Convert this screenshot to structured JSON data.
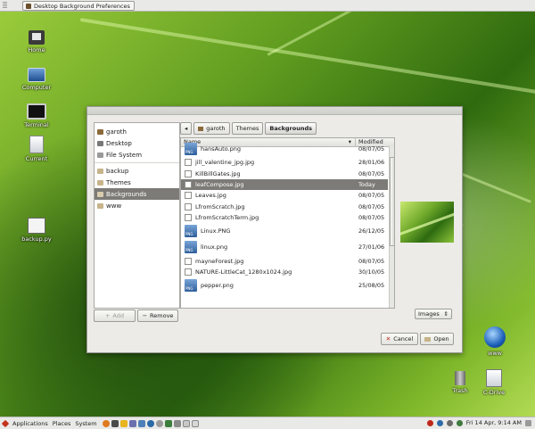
{
  "window_title": "Desktop Background Preferences",
  "desktop_icons": [
    {
      "label": "Home",
      "icon": "home-folder-icon"
    },
    {
      "label": "Computer",
      "icon": "computer-icon"
    },
    {
      "label": "Terminal",
      "icon": "terminal-icon"
    },
    {
      "label": "Current",
      "icon": "document-icon"
    },
    {
      "label": "backup.py",
      "icon": "script-icon"
    },
    {
      "label": "www",
      "icon": "globe-icon"
    },
    {
      "label": "Trash",
      "icon": "trash-icon"
    },
    {
      "label": "C-Drive",
      "icon": "drive-icon"
    }
  ],
  "places": [
    {
      "label": "garoth",
      "icon": "home-icon"
    },
    {
      "label": "Desktop",
      "icon": "desktop-icon"
    },
    {
      "label": "File System",
      "icon": "drive-icon"
    },
    {
      "label": "backup",
      "icon": "folder-icon"
    },
    {
      "label": "Themes",
      "icon": "folder-icon"
    },
    {
      "label": "Backgrounds",
      "icon": "folder-icon"
    },
    {
      "label": "www",
      "icon": "folder-icon"
    }
  ],
  "buttons": {
    "add": "Add",
    "remove": "Remove",
    "cancel": "Cancel",
    "open": "Open"
  },
  "path": [
    "garoth",
    "Themes",
    "Backgrounds"
  ],
  "columns": {
    "name": "Name",
    "modified": "Modified"
  },
  "files": [
    {
      "name": "hansAuto.png",
      "date": "08/07/05",
      "type": "png"
    },
    {
      "name": "jill_valentine_jpg.jpg",
      "date": "28/01/06",
      "type": "jpg"
    },
    {
      "name": "KillBillGates.jpg",
      "date": "08/07/05",
      "type": "jpg"
    },
    {
      "name": "leafCompose.jpg",
      "date": "Today",
      "type": "jpg",
      "selected": true
    },
    {
      "name": "Leaves.jpg",
      "date": "08/07/05",
      "type": "jpg"
    },
    {
      "name": "LfromScratch.jpg",
      "date": "08/07/05",
      "type": "jpg"
    },
    {
      "name": "LfromScratchTerm.jpg",
      "date": "08/07/05",
      "type": "jpg"
    },
    {
      "name": "Linux.PNG",
      "date": "26/12/05",
      "type": "png"
    },
    {
      "name": "linux.png",
      "date": "27/01/06",
      "type": "png"
    },
    {
      "name": "mayneForest.jpg",
      "date": "08/07/05",
      "type": "jpg"
    },
    {
      "name": "NATURE-LittleCat_1280x1024.jpg",
      "date": "30/10/05",
      "type": "jpg"
    },
    {
      "name": "pepper.png",
      "date": "25/08/05",
      "type": "png"
    }
  ],
  "filter": "Images",
  "bottom_panel": {
    "menus": [
      "Applications",
      "Places",
      "System"
    ],
    "clock": "Fri 14 Apr,  9:14 AM"
  }
}
